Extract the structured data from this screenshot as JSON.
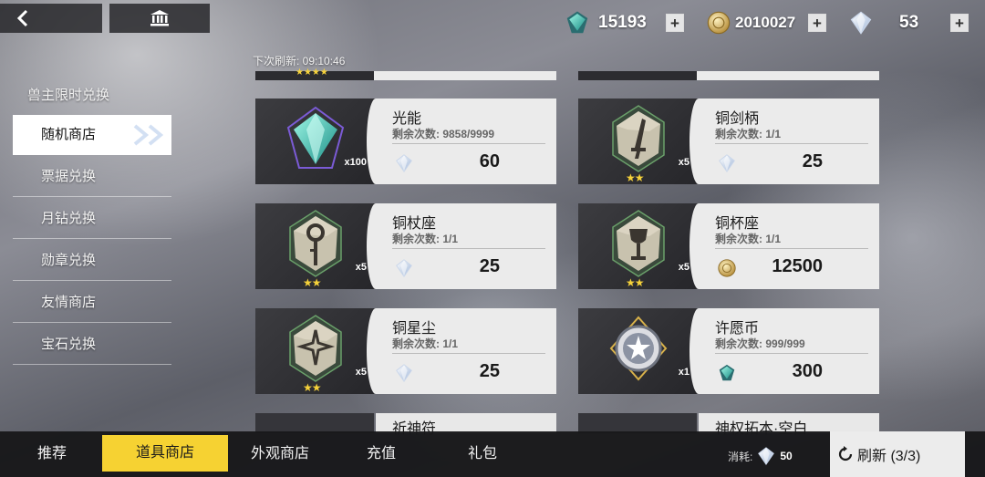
{
  "header": {
    "back_icon": "chevron-left-icon",
    "home_icon": "bank-icon",
    "currencies": [
      {
        "icon": "green-crystal-icon",
        "value": "15193"
      },
      {
        "icon": "gold-coin-icon",
        "value": "2010027"
      },
      {
        "icon": "white-diamond-icon",
        "value": "53"
      }
    ],
    "plus_label": "+"
  },
  "refresh_time": "下次刷新: 09:10:46",
  "sidebar": {
    "title": "兽主限时兑换",
    "items": [
      {
        "label": "随机商店",
        "active": true
      },
      {
        "label": "票据兑换",
        "active": false
      },
      {
        "label": "月钻兑换",
        "active": false
      },
      {
        "label": "勋章兑换",
        "active": false
      },
      {
        "label": "友情商店",
        "active": false
      },
      {
        "label": "宝石兑换",
        "active": false
      }
    ]
  },
  "items": [
    {
      "name": "光能",
      "remain": "剩余次数: 9858/9999",
      "price": "60",
      "qty": "x100",
      "stars": "",
      "cost_icon": "white-diamond-icon",
      "art": "green-crystal-art"
    },
    {
      "name": "铜剑柄",
      "remain": "剩余次数: 1/1",
      "price": "25",
      "qty": "x5",
      "stars": "★★",
      "cost_icon": "white-diamond-icon",
      "art": "sword-stone-art"
    },
    {
      "name": "铜杖座",
      "remain": "剩余次数: 1/1",
      "price": "25",
      "qty": "x5",
      "stars": "★★",
      "cost_icon": "white-diamond-icon",
      "art": "staff-stone-art"
    },
    {
      "name": "铜杯座",
      "remain": "剩余次数: 1/1",
      "price": "12500",
      "qty": "x5",
      "stars": "★★",
      "cost_icon": "gold-coin-icon",
      "art": "cup-stone-art"
    },
    {
      "name": "铜星尘",
      "remain": "剩余次数: 1/1",
      "price": "25",
      "qty": "x5",
      "stars": "★★",
      "cost_icon": "white-diamond-icon",
      "art": "star-stone-art"
    },
    {
      "name": "许愿币",
      "remain": "剩余次数: 999/999",
      "price": "300",
      "qty": "x1",
      "stars": "",
      "cost_icon": "green-crystal-icon",
      "art": "wish-coin-art"
    }
  ],
  "partial_items": [
    {
      "name": "祈神符"
    },
    {
      "name": "神权拓本·空白"
    }
  ],
  "top_partial_stars": "★★★★",
  "bottom_tabs": [
    {
      "label": "推荐",
      "active": false
    },
    {
      "label": "道具商店",
      "active": true
    },
    {
      "label": "外观商店",
      "active": false
    },
    {
      "label": "充值",
      "active": false
    },
    {
      "label": "礼包",
      "active": false
    }
  ],
  "consume": {
    "label": "消耗:",
    "value": "50",
    "icon": "white-diamond-icon"
  },
  "refresh_button": {
    "label": "刷新 (3/3)",
    "icon": "refresh-icon"
  },
  "colors": {
    "accent_yellow": "#f6d232",
    "card_light": "#ebebeb",
    "card_dark": "#2c2c30",
    "star": "#f6d23a"
  }
}
